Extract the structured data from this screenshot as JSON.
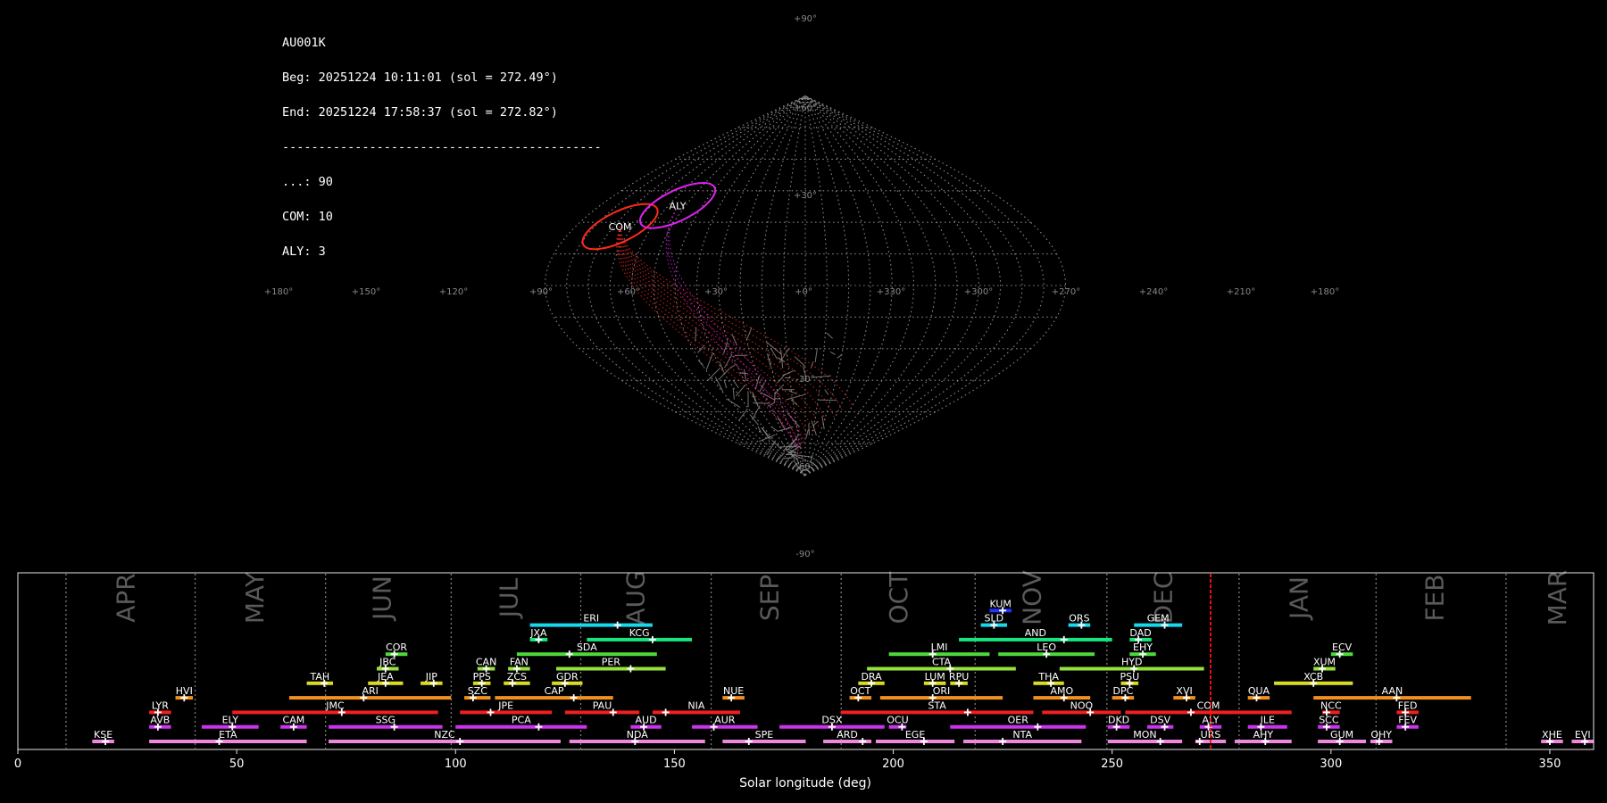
{
  "header": {
    "station": "AU001K",
    "begin": "Beg: 20251224 10:11:01 (sol = 272.49°)",
    "end": "End: 20251224 17:58:37 (sol = 272.82°)",
    "separator": "--------------------------------------------",
    "counts": [
      "...: 90",
      "COM: 10",
      "ALY: 3"
    ]
  },
  "sky_map": {
    "projection": "sinusoidal",
    "lon_labels": [
      "+180°",
      "+150°",
      "+120°",
      "+90°",
      "+60°",
      "+30°",
      "+0°",
      "+330°",
      "+300°",
      "+270°",
      "+240°",
      "+210°",
      "+180°"
    ],
    "lat_labels": [
      "+90°",
      "+60°",
      "+30°",
      "-30°",
      "-60°",
      "-90°"
    ],
    "radiants": [
      {
        "code": "COM",
        "lon": 145,
        "lat": 28,
        "color": "#ff2a1a"
      },
      {
        "code": "ALY",
        "lon": 112,
        "lat": 38,
        "color": "#dd22ee"
      }
    ],
    "colors": {
      "grid": "#8a8a8a",
      "sporadic": "#9a9a9a"
    }
  },
  "chart_data": {
    "type": "timeline",
    "xlabel": "Solar longitude (deg)",
    "xlim": [
      0,
      360
    ],
    "xticks": [
      0,
      50,
      100,
      150,
      200,
      250,
      300,
      350
    ],
    "current_sol": 272.5,
    "months": [
      {
        "name": "APR",
        "x": 25
      },
      {
        "name": "MAY",
        "x": 54.5
      },
      {
        "name": "JUN",
        "x": 83.5
      },
      {
        "name": "JUL",
        "x": 112.5
      },
      {
        "name": "AUG",
        "x": 141.5
      },
      {
        "name": "SEP",
        "x": 172
      },
      {
        "name": "OCT",
        "x": 201.5
      },
      {
        "name": "NOV",
        "x": 232
      },
      {
        "name": "DEC",
        "x": 262
      },
      {
        "name": "JAN",
        "x": 293
      },
      {
        "name": "FEB",
        "x": 324
      },
      {
        "name": "MAR",
        "x": 352
      }
    ],
    "month_boundaries": [
      11,
      40.5,
      70.3,
      99,
      128.6,
      158.4,
      188.1,
      218.7,
      248.8,
      279,
      310.3,
      340
    ],
    "showers": [
      {
        "code": "KUM",
        "start": 222,
        "end": 227,
        "peak": 225,
        "row": 9,
        "color": "#2233ff"
      },
      {
        "code": "ERI",
        "start": 117,
        "end": 145,
        "peak": 137,
        "row": 8,
        "color": "#18d8ee"
      },
      {
        "code": "SLD",
        "start": 220,
        "end": 226,
        "peak": 223,
        "row": 8,
        "color": "#18d8ee"
      },
      {
        "code": "ORS",
        "start": 240,
        "end": 245,
        "peak": 243,
        "row": 8,
        "color": "#18d8ee"
      },
      {
        "code": "GEM",
        "start": 255,
        "end": 266,
        "peak": 262,
        "row": 8,
        "color": "#18d8ee"
      },
      {
        "code": "JXA",
        "start": 117,
        "end": 121,
        "peak": 119,
        "row": 7,
        "color": "#18e57c"
      },
      {
        "code": "KCG",
        "start": 130,
        "end": 154,
        "peak": 145,
        "row": 7,
        "color": "#18e57c"
      },
      {
        "code": "AND",
        "start": 215,
        "end": 250,
        "peak": 239,
        "row": 7,
        "color": "#18e57c"
      },
      {
        "code": "DAD",
        "start": 254,
        "end": 259,
        "peak": 256,
        "row": 7,
        "color": "#18e57c"
      },
      {
        "code": "COR",
        "start": 84,
        "end": 89,
        "peak": 86,
        "row": 6,
        "color": "#4fd83c"
      },
      {
        "code": "SDA",
        "start": 114,
        "end": 146,
        "peak": 126,
        "row": 6,
        "color": "#4fd83c"
      },
      {
        "code": "LMI",
        "start": 199,
        "end": 222,
        "peak": 209,
        "row": 6,
        "color": "#4fd83c"
      },
      {
        "code": "LEO",
        "start": 224,
        "end": 246,
        "peak": 235,
        "row": 6,
        "color": "#4fd83c"
      },
      {
        "code": "EHY",
        "start": 254,
        "end": 260,
        "peak": 257,
        "row": 6,
        "color": "#4fd83c"
      },
      {
        "code": "ECV",
        "start": 300,
        "end": 305,
        "peak": 302,
        "row": 6,
        "color": "#4fd83c"
      },
      {
        "code": "JBC",
        "start": 82,
        "end": 87,
        "peak": 84,
        "row": 5,
        "color": "#96e23c"
      },
      {
        "code": "CAN",
        "start": 105,
        "end": 109,
        "peak": 107,
        "row": 5,
        "color": "#96e23c"
      },
      {
        "code": "FAN",
        "start": 112,
        "end": 117,
        "peak": 114,
        "row": 5,
        "color": "#96e23c"
      },
      {
        "code": "PER",
        "start": 123,
        "end": 148,
        "peak": 140,
        "row": 5,
        "color": "#96e23c"
      },
      {
        "code": "CTA",
        "start": 194,
        "end": 228,
        "peak": 213,
        "row": 5,
        "color": "#96e23c"
      },
      {
        "code": "HYD",
        "start": 238,
        "end": 271,
        "peak": 255,
        "row": 5,
        "color": "#96e23c"
      },
      {
        "code": "XUM",
        "start": 296,
        "end": 301,
        "peak": 298,
        "row": 5,
        "color": "#96e23c"
      },
      {
        "code": "TAH",
        "start": 66,
        "end": 72,
        "peak": 70,
        "row": 4,
        "color": "#dada20"
      },
      {
        "code": "JEA",
        "start": 80,
        "end": 88,
        "peak": 84,
        "row": 4,
        "color": "#dada20"
      },
      {
        "code": "JIP",
        "start": 92,
        "end": 97,
        "peak": 95,
        "row": 4,
        "color": "#dada20"
      },
      {
        "code": "PPS",
        "start": 104,
        "end": 108,
        "peak": 106,
        "row": 4,
        "color": "#dada20"
      },
      {
        "code": "ZCS",
        "start": 111,
        "end": 117,
        "peak": 113,
        "row": 4,
        "color": "#dada20"
      },
      {
        "code": "GDR",
        "start": 122,
        "end": 129,
        "peak": 125,
        "row": 4,
        "color": "#dada20"
      },
      {
        "code": "DRA",
        "start": 192,
        "end": 198,
        "peak": 195,
        "row": 4,
        "color": "#dada20"
      },
      {
        "code": "LUM",
        "start": 207,
        "end": 212,
        "peak": 209,
        "row": 4,
        "color": "#dada20"
      },
      {
        "code": "RPU",
        "start": 213,
        "end": 217,
        "peak": 215,
        "row": 4,
        "color": "#dada20"
      },
      {
        "code": "THA",
        "start": 232,
        "end": 239,
        "peak": 236,
        "row": 4,
        "color": "#dada20"
      },
      {
        "code": "PSU",
        "start": 252,
        "end": 256,
        "peak": 254,
        "row": 4,
        "color": "#dada20"
      },
      {
        "code": "XCB",
        "start": 287,
        "end": 305,
        "peak": 296,
        "row": 4,
        "color": "#dada20"
      },
      {
        "code": "HVI",
        "start": 36,
        "end": 40,
        "peak": 38,
        "row": 3,
        "color": "#f09020"
      },
      {
        "code": "ARI",
        "start": 62,
        "end": 99,
        "peak": 79,
        "row": 3,
        "color": "#f09020"
      },
      {
        "code": "SZC",
        "start": 102,
        "end": 108,
        "peak": 104,
        "row": 3,
        "color": "#f09020"
      },
      {
        "code": "CAP",
        "start": 109,
        "end": 136,
        "peak": 127,
        "row": 3,
        "color": "#f09020"
      },
      {
        "code": "NUE",
        "start": 161,
        "end": 166,
        "peak": 163,
        "row": 3,
        "color": "#f09020"
      },
      {
        "code": "OCT",
        "start": 190,
        "end": 195,
        "peak": 192,
        "row": 3,
        "color": "#f09020"
      },
      {
        "code": "ORI",
        "start": 197,
        "end": 225,
        "peak": 209,
        "row": 3,
        "color": "#f09020"
      },
      {
        "code": "AMO",
        "start": 232,
        "end": 245,
        "peak": 239,
        "row": 3,
        "color": "#f09020"
      },
      {
        "code": "DPC",
        "start": 250,
        "end": 255,
        "peak": 253,
        "row": 3,
        "color": "#f09020"
      },
      {
        "code": "XVI",
        "start": 264,
        "end": 269,
        "peak": 267,
        "row": 3,
        "color": "#f09020"
      },
      {
        "code": "QUA",
        "start": 281,
        "end": 286,
        "peak": 283,
        "row": 3,
        "color": "#f09020"
      },
      {
        "code": "AAN",
        "start": 296,
        "end": 332,
        "peak": 315,
        "row": 3,
        "color": "#f09020"
      },
      {
        "code": "LYR",
        "start": 30,
        "end": 35,
        "peak": 32,
        "row": 2,
        "color": "#ee2020"
      },
      {
        "code": "JMC",
        "start": 49,
        "end": 96,
        "peak": 74,
        "row": 2,
        "color": "#ee2020"
      },
      {
        "code": "JPE",
        "start": 101,
        "end": 122,
        "peak": 108,
        "row": 2,
        "color": "#ee2020"
      },
      {
        "code": "PAU",
        "start": 125,
        "end": 142,
        "peak": 136,
        "row": 2,
        "color": "#ee2020"
      },
      {
        "code": "NIA",
        "start": 145,
        "end": 165,
        "peak": 148,
        "row": 2,
        "color": "#ee2020"
      },
      {
        "code": "STA",
        "start": 188,
        "end": 232,
        "peak": 217,
        "row": 2,
        "color": "#ee2020"
      },
      {
        "code": "NOO",
        "start": 234,
        "end": 252,
        "peak": 245,
        "row": 2,
        "color": "#ee2020"
      },
      {
        "code": "COM",
        "start": 253,
        "end": 291,
        "peak": 268,
        "row": 2,
        "color": "#ee2020"
      },
      {
        "code": "NCC",
        "start": 298,
        "end": 302,
        "peak": 299,
        "row": 2,
        "color": "#ee2020"
      },
      {
        "code": "FED",
        "start": 315,
        "end": 320,
        "peak": 317,
        "row": 2,
        "color": "#ee2020"
      },
      {
        "code": "AVB",
        "start": 30,
        "end": 35,
        "peak": 32,
        "row": 1,
        "color": "#cc33ee"
      },
      {
        "code": "ELY",
        "start": 42,
        "end": 55,
        "peak": 49,
        "row": 1,
        "color": "#cc33ee"
      },
      {
        "code": "CAM",
        "start": 60,
        "end": 66,
        "peak": 63,
        "row": 1,
        "color": "#cc33ee"
      },
      {
        "code": "SSG",
        "start": 71,
        "end": 97,
        "peak": 86,
        "row": 1,
        "color": "#cc33ee"
      },
      {
        "code": "PCA",
        "start": 100,
        "end": 130,
        "peak": 119,
        "row": 1,
        "color": "#cc33ee"
      },
      {
        "code": "AUD",
        "start": 140,
        "end": 147,
        "peak": 143,
        "row": 1,
        "color": "#cc33ee"
      },
      {
        "code": "AUR",
        "start": 154,
        "end": 169,
        "peak": 159,
        "row": 1,
        "color": "#cc33ee"
      },
      {
        "code": "DSX",
        "start": 174,
        "end": 198,
        "peak": 186,
        "row": 1,
        "color": "#cc33ee"
      },
      {
        "code": "OCU",
        "start": 199,
        "end": 203,
        "peak": 202,
        "row": 1,
        "color": "#cc33ee"
      },
      {
        "code": "OER",
        "start": 213,
        "end": 244,
        "peak": 233,
        "row": 1,
        "color": "#cc33ee"
      },
      {
        "code": "DKD",
        "start": 249,
        "end": 254,
        "peak": 251,
        "row": 1,
        "color": "#cc33ee"
      },
      {
        "code": "DSV",
        "start": 258,
        "end": 264,
        "peak": 262,
        "row": 1,
        "color": "#cc33ee"
      },
      {
        "code": "ALY",
        "start": 270,
        "end": 275,
        "peak": 272,
        "row": 1,
        "color": "#cc33ee"
      },
      {
        "code": "ILE",
        "start": 281,
        "end": 290,
        "peak": 284,
        "row": 1,
        "color": "#cc33ee"
      },
      {
        "code": "SCC",
        "start": 297,
        "end": 302,
        "peak": 299,
        "row": 1,
        "color": "#cc33ee"
      },
      {
        "code": "FEV",
        "start": 315,
        "end": 320,
        "peak": 317,
        "row": 1,
        "color": "#cc33ee"
      },
      {
        "code": "KSE",
        "start": 17,
        "end": 22,
        "peak": 20,
        "row": 0,
        "color": "#ee88dd"
      },
      {
        "code": "ETA",
        "start": 30,
        "end": 66,
        "peak": 46,
        "row": 0,
        "color": "#ee88dd"
      },
      {
        "code": "NZC",
        "start": 71,
        "end": 124,
        "peak": 101,
        "row": 0,
        "color": "#ee88dd"
      },
      {
        "code": "NDA",
        "start": 126,
        "end": 157,
        "peak": 141,
        "row": 0,
        "color": "#ee88dd"
      },
      {
        "code": "SPE",
        "start": 161,
        "end": 180,
        "peak": 167,
        "row": 0,
        "color": "#ee88dd"
      },
      {
        "code": "ARD",
        "start": 184,
        "end": 195,
        "peak": 193,
        "row": 0,
        "color": "#ee88dd"
      },
      {
        "code": "EGE",
        "start": 196,
        "end": 214,
        "peak": 207,
        "row": 0,
        "color": "#ee88dd"
      },
      {
        "code": "NTA",
        "start": 216,
        "end": 243,
        "peak": 225,
        "row": 0,
        "color": "#ee88dd"
      },
      {
        "code": "MON",
        "start": 249,
        "end": 266,
        "peak": 261,
        "row": 0,
        "color": "#ee88dd"
      },
      {
        "code": "URS",
        "start": 269,
        "end": 276,
        "peak": 270,
        "row": 0,
        "color": "#ee88dd"
      },
      {
        "code": "AHY",
        "start": 278,
        "end": 291,
        "peak": 285,
        "row": 0,
        "color": "#ee88dd"
      },
      {
        "code": "GUM",
        "start": 297,
        "end": 308,
        "peak": 302,
        "row": 0,
        "color": "#ee88dd"
      },
      {
        "code": "OHY",
        "start": 309,
        "end": 314,
        "peak": 311,
        "row": 0,
        "color": "#ee88dd"
      },
      {
        "code": "XHE",
        "start": 348,
        "end": 353,
        "peak": 350,
        "row": 0,
        "color": "#ee88dd"
      },
      {
        "code": "EVI",
        "start": 355,
        "end": 360,
        "peak": 358,
        "row": 0,
        "color": "#ee88dd"
      }
    ]
  }
}
